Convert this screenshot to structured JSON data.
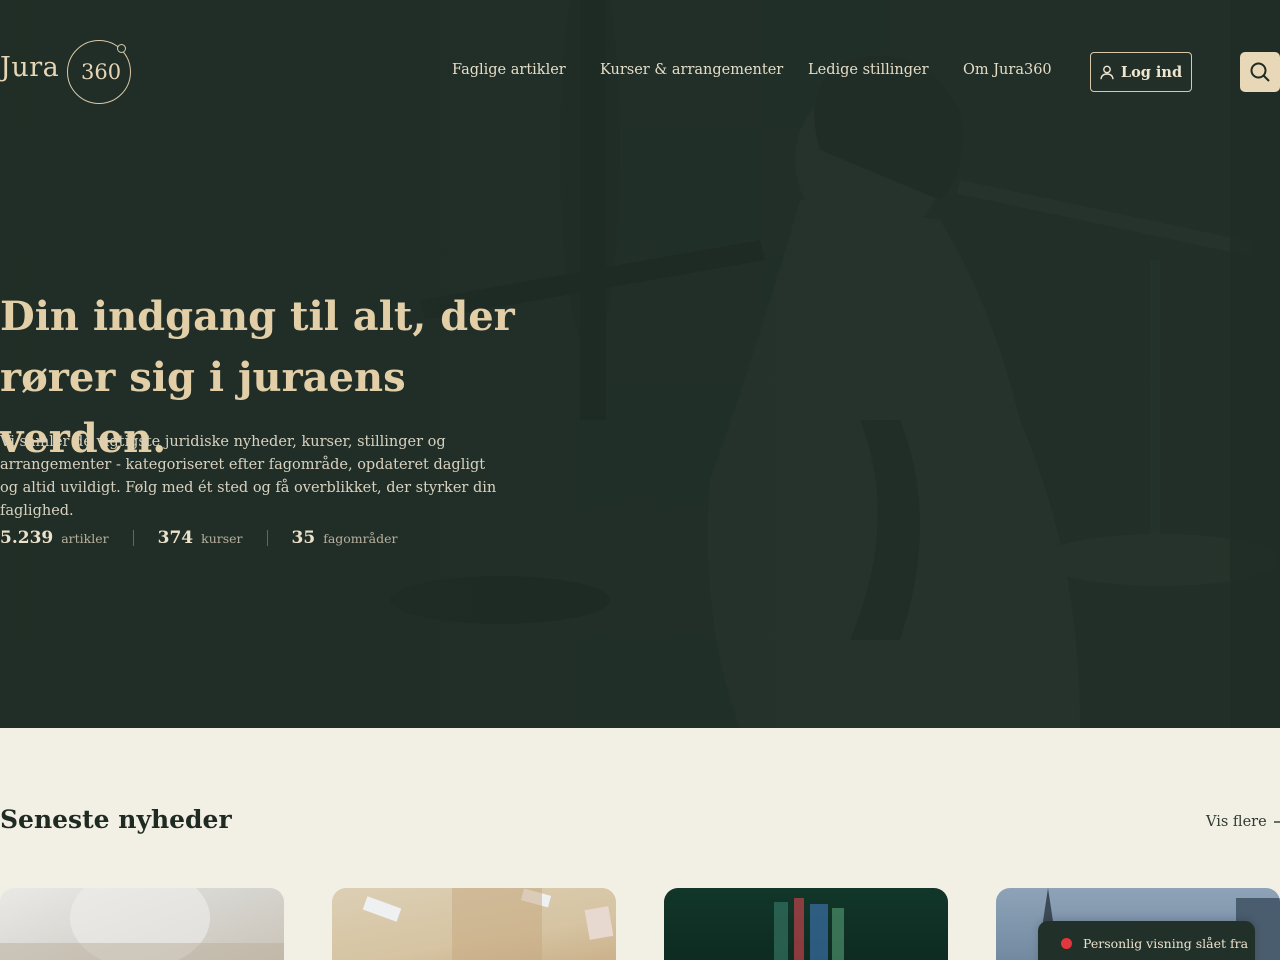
{
  "brand": {
    "logo_word": "Jura",
    "logo_number": "360"
  },
  "nav": {
    "items": [
      {
        "label": "Faglige artikler"
      },
      {
        "label": "Kurser & arrangementer"
      },
      {
        "label": "Ledige stillinger"
      },
      {
        "label": "Om Jura360"
      }
    ],
    "login_label": "Log ind"
  },
  "hero": {
    "title_line1": "Din indgang til alt, der",
    "title_line2": "rører sig i juraens verden.",
    "subtitle": "Vi samler de vigtigste juridiske nyheder, kurser, stillinger og arrangementer - kategoriseret efter fagområde, opdateret dagligt og altid uvildigt. Følg med ét sted og få overblikket, der styrker din faglighed.",
    "stats": [
      {
        "value": "5.239",
        "label": "artikler"
      },
      {
        "value": "374",
        "label": "kurser"
      },
      {
        "value": "35",
        "label": "fagområder"
      }
    ]
  },
  "news": {
    "title": "Seneste nyheder",
    "more_label": "Vis flere"
  },
  "toast": {
    "text": "Personlig visning slået fra",
    "status_color": "#e0383e"
  },
  "colors": {
    "hero_bg": "#22302a",
    "accent": "#e2cfa8",
    "page_bg": "#f2efe4"
  }
}
